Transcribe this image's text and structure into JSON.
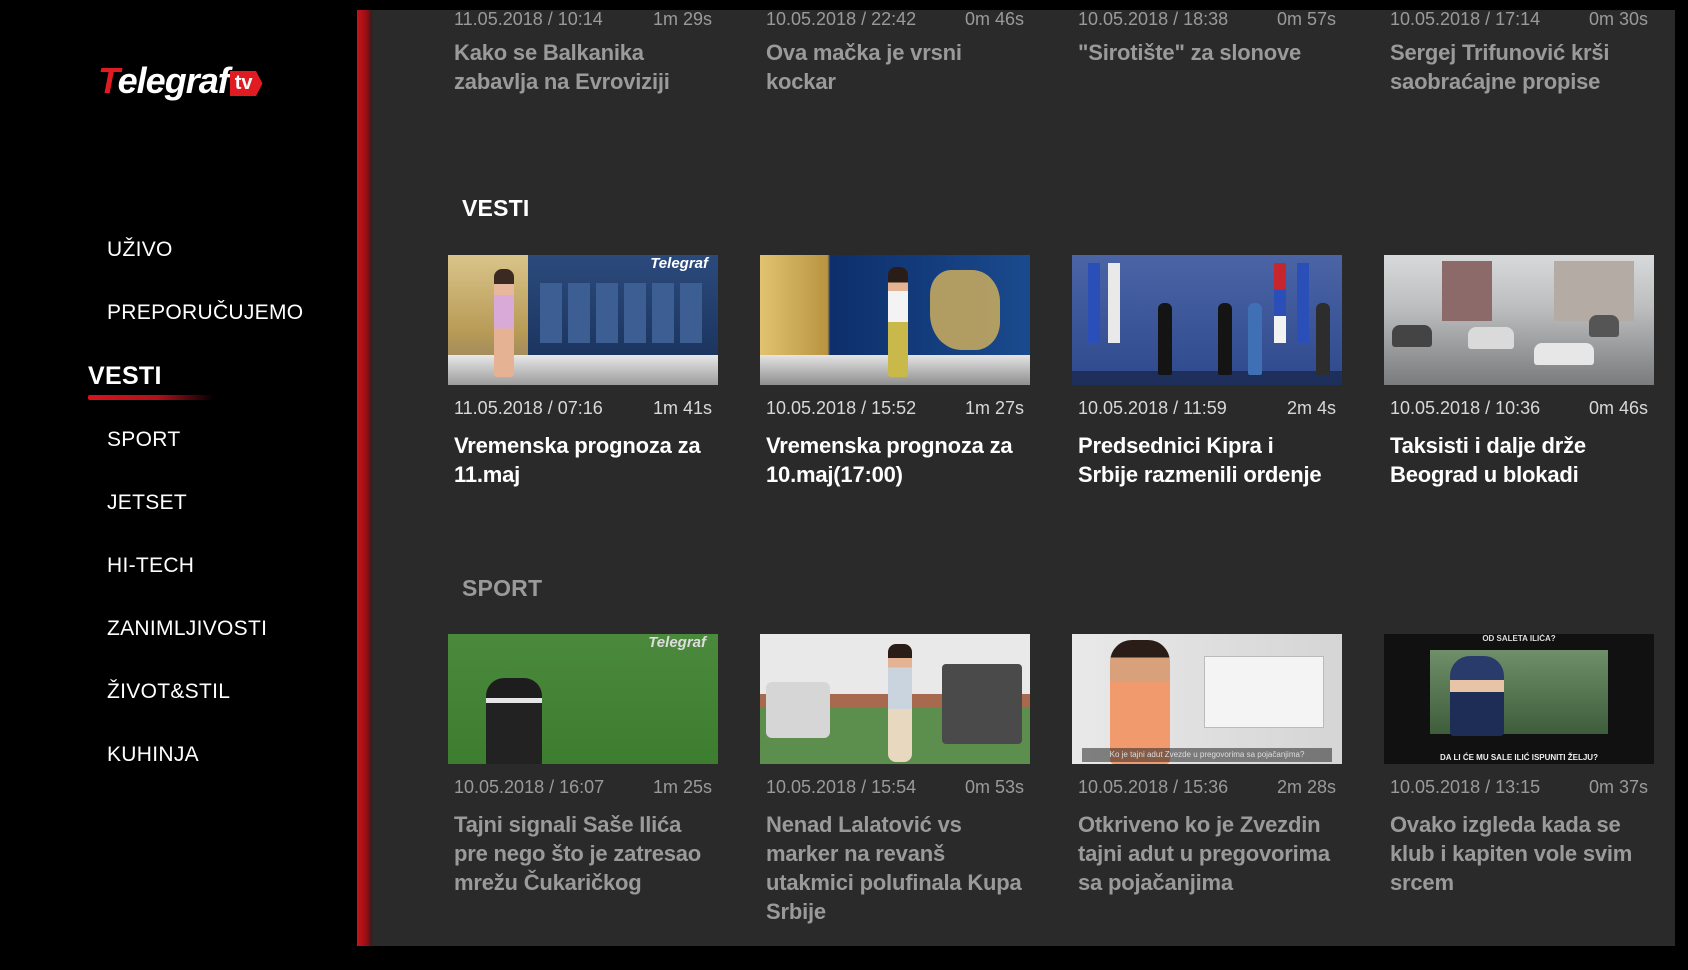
{
  "brand": {
    "logo_text": "Telegraf",
    "logo_suffix": "tv",
    "accent": "#e01b22"
  },
  "menu": {
    "items": [
      {
        "label": "UŽIVO"
      },
      {
        "label": "PREPORUČUJEMO"
      },
      {
        "label": "VESTI",
        "active": true
      },
      {
        "label": "SPORT"
      },
      {
        "label": "JETSET"
      },
      {
        "label": "HI-TECH"
      },
      {
        "label": "ZANIMLJIVOSTI"
      },
      {
        "label": "ŽIVOT&STIL"
      },
      {
        "label": "KUHINJA"
      }
    ]
  },
  "top_row": {
    "cards": [
      {
        "date": "11.05.2018 / 10:14",
        "duration": "1m 29s",
        "title": "Kako se Balkanika zabavlja na Evroviziji"
      },
      {
        "date": "10.05.2018 / 22:42",
        "duration": "0m 46s",
        "title": "Ova mačka je vrsni kockar"
      },
      {
        "date": "10.05.2018 / 18:38",
        "duration": "0m 57s",
        "title": "\"Sirotište\" za slonove"
      },
      {
        "date": "10.05.2018 / 17:14",
        "duration": "0m 30s",
        "title": "Sergej Trifunović krši saobraćajne propise"
      }
    ]
  },
  "vesti": {
    "title": "VESTI",
    "cards": [
      {
        "date": "11.05.2018 / 07:16",
        "duration": "1m 41s",
        "title": "Vremenska prognoza za 11.maj",
        "thumb": "weather-studio-1"
      },
      {
        "date": "10.05.2018 / 15:52",
        "duration": "1m 27s",
        "title": "Vremenska prognoza za 10.maj(17:00)",
        "thumb": "weather-studio-2"
      },
      {
        "date": "10.05.2018 / 11:59",
        "duration": "2m 4s",
        "title": "Predsednici Kipra i Srbije razmenili ordenje",
        "thumb": "ceremony-flags"
      },
      {
        "date": "10.05.2018 / 10:36",
        "duration": "0m 46s",
        "title": "Taksisti i dalje drže Beograd u blokadi",
        "thumb": "street-taxis"
      }
    ]
  },
  "sport": {
    "title": "SPORT",
    "cards": [
      {
        "date": "10.05.2018 / 16:07",
        "duration": "1m 25s",
        "title": "Tajni signali Saše Ilića pre nego što je zatresao mrežu Čukaričkog",
        "thumb": "football-player"
      },
      {
        "date": "10.05.2018 / 15:54",
        "duration": "0m 53s",
        "title": "Nenad Lalatović vs marker na revanš utakmici polufinala Kupa Srbije",
        "thumb": "pitch-sideline"
      },
      {
        "date": "10.05.2018 / 15:36",
        "duration": "2m 28s",
        "title": "Otkriveno ko je Zvezdin tajni adut u pregovorima sa pojačanjima",
        "thumb": "interview",
        "caption": "Ko je tajni adut Zvezde u pregovorima sa pojačanjima?"
      },
      {
        "date": "10.05.2018 / 13:15",
        "duration": "0m 37s",
        "title": "Ovako izgleda kada se klub i kapiten vole svim srcem",
        "thumb": "fan-interview",
        "caption_top": "OD SALETA ILIĆA?",
        "caption_bottom": "DA LI ĆE MU SALE ILIĆ ISPUNITI ŽELJU?"
      }
    ]
  },
  "thumb_watermark": "Telegraf"
}
